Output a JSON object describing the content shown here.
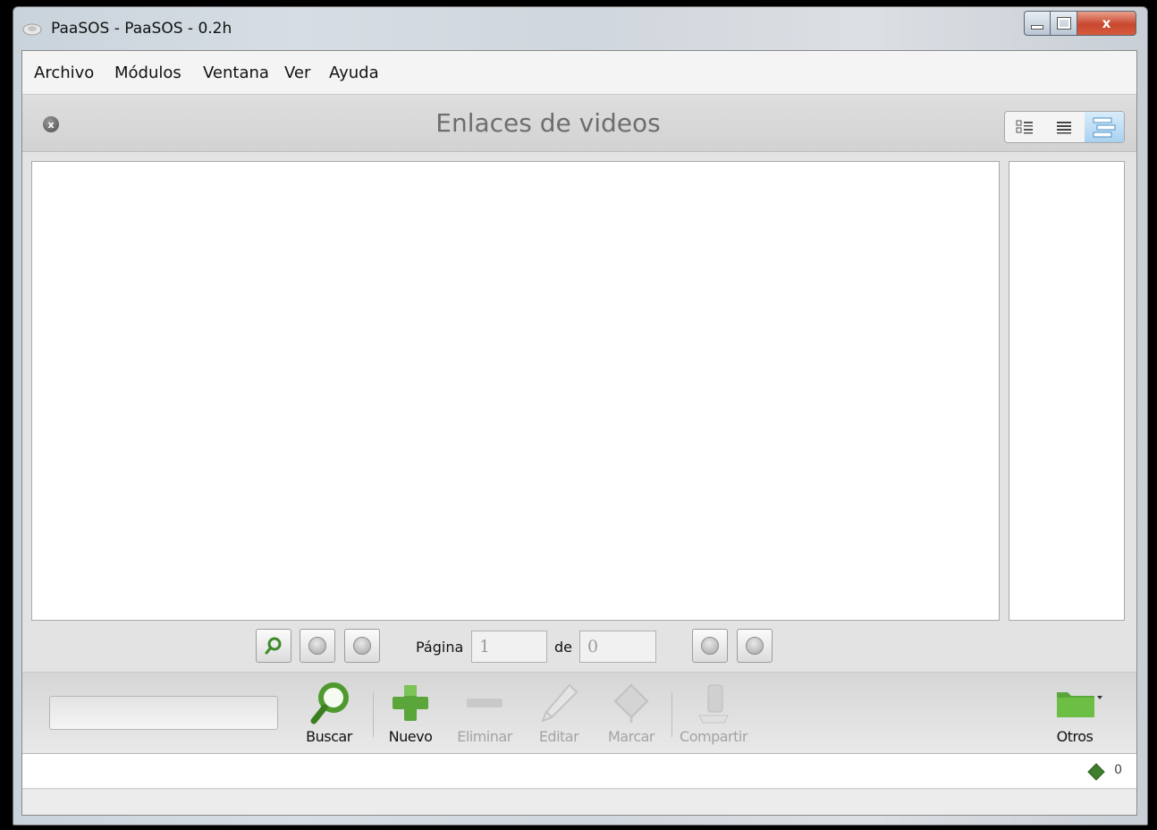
{
  "window": {
    "title": "PaaSOS - PaaSOS - 0.2h",
    "close_glyph": "x"
  },
  "menu": [
    {
      "label": "Archivo"
    },
    {
      "label": "Módulos"
    },
    {
      "label": "Ventana"
    },
    {
      "label": "Ver"
    },
    {
      "label": "Ayuda"
    }
  ],
  "module": {
    "title": "Enlaces de videos",
    "view_modes": [
      "details-view-icon",
      "list-view-icon",
      "tree-view-icon"
    ],
    "active_view": "tree-view-icon"
  },
  "pager": {
    "page_label": "Página",
    "page_value": "1",
    "of_label": "de",
    "total_value": "0"
  },
  "toolbar": {
    "buscar": "Buscar",
    "nuevo": "Nuevo",
    "eliminar": "Eliminar",
    "editar": "Editar",
    "marcar": "Marcar",
    "compartir": "Compartir",
    "otros": "Otros"
  },
  "status": {
    "count": "0"
  },
  "colors": {
    "accent_green": "#5aa63a",
    "disabled_text": "#a4a4a4",
    "title_grey": "#6e6e6e"
  }
}
